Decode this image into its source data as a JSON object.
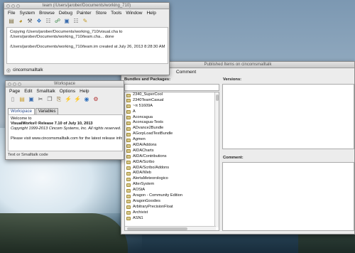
{
  "transcript": {
    "title": "team (/Users/jarober/Documents/working_710)",
    "menu": [
      "File",
      "System",
      "Browse",
      "Debug",
      "Painter",
      "Store",
      "Tools",
      "Window",
      "Help"
    ],
    "toolbar_icons": [
      "document-icon",
      "inspect-icon",
      "tools-icon",
      "open-icon",
      "database-icon",
      "link-icon",
      "window-icon",
      "database-2-icon",
      "notepad-icon"
    ],
    "lines": [
      "Copying /Users/jarober/Documents/working_710/visual.cha  to",
      "/Users/jarober/Documents/working_710/team.cha... done",
      "",
      "/Users/jarober/Documents/working_710/team.im created at July 26, 2013 8:28:30 AM"
    ],
    "status": "cincomsmalltalk"
  },
  "workspace": {
    "title": "Workspace",
    "menu": [
      "Page",
      "Edit",
      "Smalltalk",
      "Options",
      "Help"
    ],
    "toolbar_icons": [
      "new-page-icon",
      "open-file-icon",
      "save-icon",
      "cut-icon",
      "copy-icon",
      "paste-icon",
      "do-it-icon",
      "print-it-icon",
      "inspect-icon",
      "debug-icon"
    ],
    "tabs": [
      "Workspace",
      "Variables"
    ],
    "lines": [
      {
        "text": "Welcome to",
        "style": "normal"
      },
      {
        "text": "VisualWorks® Release  7.10 of July 10, 2013",
        "style": "bold"
      },
      {
        "text": "Copyright 1999-2013 Cincom Systems, Inc. All rights reserved.",
        "style": "italic"
      },
      {
        "text": "",
        "style": "normal"
      },
      {
        "text": "Please visit www.cincomsmalltalk.com for the latest release info",
        "style": "normal"
      }
    ],
    "status": "Text or Smalltalk code"
  },
  "published": {
    "title": "Published Items on cincomsmalltalk",
    "menu": [
      "Comment"
    ],
    "bundles_label": "Bundles and Packages:",
    "versions_label": "Versions:",
    "comment_label": "Comment:",
    "items": [
      "2340_SuperCool",
      "2340TeamCasual",
      "~π 51609A",
      "A",
      "Aconcagua",
      "Aconcagua-Tests",
      "ADvance2Bundle",
      "AGorpLoadTestBundle",
      "Agmen",
      "AIDA/Addons",
      "AIDACharts",
      "AIDA/Contributions",
      "AIDA/Scribo",
      "AIDA/Scribo/Addons",
      "AIDA/Web",
      "AlertaMeteorologico",
      "AlterSystem",
      "AOStA",
      "Aragon - Community Edition",
      "AragonGoodies",
      "ArbitraryPrecisionFloat",
      "Archivist",
      "ASN1"
    ]
  }
}
